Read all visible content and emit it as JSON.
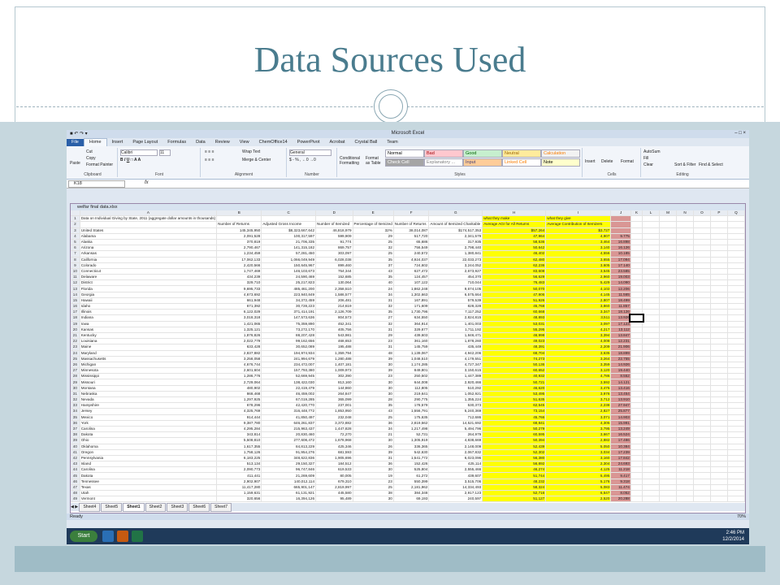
{
  "slide": {
    "title": "Data Sources Used"
  },
  "excel": {
    "window_title": "Microsoft Excel",
    "tabs": [
      "File",
      "Home",
      "Insert",
      "Page Layout",
      "Formulas",
      "Data",
      "Review",
      "View",
      "ChemOffice14",
      "PowerPivot",
      "Acrobat",
      "Crystal Ball",
      "Team"
    ],
    "ribbon": {
      "clipboard": {
        "paste": "Paste",
        "cut": "Cut",
        "copy": "Copy",
        "painter": "Format Painter",
        "label": "Clipboard"
      },
      "font": {
        "name": "Calibri",
        "size": "11",
        "label": "Font"
      },
      "alignment": {
        "wrap": "Wrap Text",
        "merge": "Merge & Center",
        "label": "Alignment"
      },
      "number": {
        "format": "General",
        "label": "Number"
      },
      "styles": {
        "cond": "Conditional Formatting",
        "table": "Format as Table",
        "label": "Styles",
        "cells": [
          {
            "text": "Normal",
            "bg": "#ffffff",
            "fg": "#000000"
          },
          {
            "text": "Bad",
            "bg": "#ffc7ce",
            "fg": "#9c0006"
          },
          {
            "text": "Good",
            "bg": "#c6efce",
            "fg": "#006100"
          },
          {
            "text": "Neutral",
            "bg": "#ffeb9c",
            "fg": "#9c6500"
          },
          {
            "text": "Calculation",
            "bg": "#f2f2f2",
            "fg": "#fa7d00"
          },
          {
            "text": "Check Cell",
            "bg": "#a5a5a5",
            "fg": "#ffffff"
          },
          {
            "text": "Explanatory ...",
            "bg": "#ffffff",
            "fg": "#7f7f7f"
          },
          {
            "text": "Input",
            "bg": "#ffcc99",
            "fg": "#3f3f76"
          },
          {
            "text": "Linked Cell",
            "bg": "#ffffff",
            "fg": "#fa7d00"
          },
          {
            "text": "Note",
            "bg": "#ffffcc",
            "fg": "#000000"
          }
        ]
      },
      "cells": {
        "insert": "Insert",
        "delete": "Delete",
        "format": "Format",
        "label": "Cells"
      },
      "editing": {
        "autosum": "AutoSum",
        "fill": "Fill",
        "clear": "Clear",
        "sort": "Sort & Filter",
        "find": "Find & Select",
        "label": "Editing"
      }
    },
    "namebox": "K18",
    "fx": "fx",
    "workbook_title": "welfar final data.xlsx",
    "columns": [
      "A",
      "B",
      "C",
      "D",
      "E",
      "F",
      "G",
      "H",
      "I",
      "J",
      "K",
      "L",
      "M",
      "N",
      "O",
      "P",
      "Q"
    ],
    "header_row1": {
      "a": "Data on Individual Giving by State, 2011 (aggregate dollar amounts in thousands)",
      "h": "what they make",
      "i": "what they give"
    },
    "header_row2": [
      "",
      "Number of Returns",
      "Adjusted Gross Income",
      "Number of Itemized",
      "Percentage of Itemized",
      "Number of Returns",
      "Amount of Itemized Charitable",
      "Average AGI for All Returns",
      "Average Contribution of Itemizers",
      ""
    ],
    "rows": [
      [
        "United States",
        "145,345,950",
        "$8,323,667,642",
        "46,818,979",
        "32%",
        "38,014,087",
        "$174,517,353",
        "$57,264",
        "$3,727",
        ""
      ],
      [
        "Alabama",
        "2,091,528",
        "100,317,597",
        "599,909",
        "29",
        "517,720",
        "2,341,579",
        "47,964",
        "4,907",
        "9.775"
      ],
      [
        "Alaska",
        "370,819",
        "21,706,335",
        "91,774",
        "25",
        "65,686",
        "317,935",
        "58,536",
        "3,464",
        "16.898"
      ],
      [
        "Arizona",
        "2,790,467",
        "141,315,182",
        "869,757",
        "32",
        "756,549",
        "2,798,440",
        "50,642",
        "3,140",
        "16.126"
      ],
      [
        "Arkansas",
        "1,234,459",
        "57,281,450",
        "303,097",
        "25",
        "240,572",
        "1,380,841",
        "46,402",
        "4,556",
        "10.185"
      ],
      [
        "California",
        "17,062,133",
        "1,066,049,949",
        "6,028,038",
        "35",
        "4,924,037",
        "22,033,273",
        "62,480",
        "3,655",
        "17.094"
      ],
      [
        "Colorado",
        "2,420,566",
        "150,645,967",
        "899,460",
        "37",
        "724,602",
        "3,244,052",
        "62,236",
        "3,605",
        "17.140"
      ],
      [
        "Connecticut",
        "1,747,469",
        "146,103,673",
        "754,344",
        "43",
        "627,472",
        "2,673,927",
        "83,608",
        "3,545",
        "23.585"
      ],
      [
        "Delaware",
        "434,239",
        "24,590,469",
        "152,685",
        "35",
        "124,457",
        "454,370",
        "56,629",
        "2,960",
        "19.003"
      ],
      [
        "District",
        "329,710",
        "25,217,823",
        "130,064",
        "40",
        "107,122",
        "710,044",
        "76,483",
        "5,429",
        "14.090"
      ],
      [
        "Florida",
        "9,695,733",
        "485,461,200",
        "2,358,510",
        "24",
        "1,862,248",
        "9,674,105",
        "50,070",
        "4,102",
        "12.206"
      ],
      [
        "Georgia",
        "4,673,692",
        "223,940,849",
        "1,586,577",
        "34",
        "1,302,663",
        "6,575,664",
        "47,906",
        "4,145",
        "11.565"
      ],
      [
        "Hawaii",
        "661,948",
        "34,372,459",
        "206,481",
        "31",
        "167,891",
        "579,539",
        "51,926",
        "2,807",
        "18.499"
      ],
      [
        "Idaho",
        "671,392",
        "30,728,223",
        "214,619",
        "32",
        "171,609",
        "828,328",
        "45,768",
        "3,860",
        "11.857"
      ],
      [
        "Illinois",
        "6,122,029",
        "371,414,191",
        "2,126,709",
        "35",
        "1,730,796",
        "7,117,252",
        "60,668",
        "3,347",
        "18.126"
      ],
      [
        "Indiana",
        "3,018,318",
        "147,573,636",
        "804,573",
        "27",
        "634,550",
        "2,824,815",
        "48,893",
        "3,511",
        "13.926"
      ],
      [
        "Iowa",
        "1,421,065",
        "75,359,890",
        "452,341",
        "32",
        "364,914",
        "1,401,003",
        "53,031",
        "3,097",
        "17.123"
      ],
      [
        "Kansas",
        "1,325,121",
        "73,272,170",
        "405,756",
        "31",
        "329,677",
        "1,711,192",
        "55,295",
        "4,217",
        "13.112"
      ],
      [
        "Kentucky",
        "1,876,826",
        "88,207,428",
        "543,981",
        "29",
        "439,603",
        "1,846,471",
        "46,998",
        "3,394",
        "13.847"
      ],
      [
        "Louisiana",
        "2,022,779",
        "99,162,656",
        "468,653",
        "23",
        "361,160",
        "1,878,260",
        "49,023",
        "4,008",
        "12.231"
      ],
      [
        "Maine",
        "633,428",
        "30,652,089",
        "195,488",
        "31",
        "145,759",
        "435,449",
        "48,391",
        "2,209",
        "21.906"
      ],
      [
        "Maryland",
        "2,837,882",
        "194,974,934",
        "1,359,794",
        "48",
        "1,139,067",
        "4,942,206",
        "68,704",
        "3,635",
        "18.899"
      ],
      [
        "Massachusetts",
        "3,258,058",
        "241,994,679",
        "1,280,488",
        "39",
        "1,048,510",
        "4,179,551",
        "74,273",
        "3,264",
        "22.755"
      ],
      [
        "Michigan",
        "4,676,744",
        "234,472,007",
        "1,407,181",
        "30",
        "1,174,285",
        "4,727,347",
        "50,136",
        "3,359",
        "14.926"
      ],
      [
        "Minnesota",
        "2,601,604",
        "157,793,380",
        "1,009,973",
        "39",
        "849,801",
        "3,150,615",
        "60,652",
        "3,120",
        "19.440"
      ],
      [
        "Mississippi",
        "1,286,776",
        "52,669,945",
        "302,390",
        "23",
        "250,502",
        "1,447,389",
        "40,932",
        "4,786",
        "8.552"
      ],
      [
        "Missouri",
        "2,729,064",
        "138,422,030",
        "813,160",
        "30",
        "644,008",
        "2,920,466",
        "50,721",
        "3,592",
        "14.121"
      ],
      [
        "Montana",
        "480,902",
        "22,419,479",
        "144,860",
        "30",
        "112,805",
        "510,292",
        "46,620",
        "3,475",
        "13.416"
      ],
      [
        "Nebraska",
        "868,468",
        "46,459,002",
        "264,847",
        "30",
        "219,641",
        "1,052,921",
        "53,495",
        "3,976",
        "13.454"
      ],
      [
        "Nevada",
        "1,297,925",
        "67,019,285",
        "365,099",
        "28",
        "290,775",
        "1,355,224",
        "51,635",
        "3,712",
        "13.910"
      ],
      [
        "Hampshire",
        "678,296",
        "42,420,770",
        "237,001",
        "35",
        "178,579",
        "530,373",
        "62,545",
        "2,238",
        "27.947"
      ],
      [
        "Jersey",
        "4,325,769",
        "316,448,772",
        "1,853,950",
        "43",
        "1,556,791",
        "5,240,369",
        "73,154",
        "2,827",
        "25.877"
      ],
      [
        "Mexico",
        "914,444",
        "41,850,497",
        "232,048",
        "25",
        "175,635",
        "712,686",
        "45,766",
        "3,071",
        "14.903"
      ],
      [
        "York",
        "9,387,780",
        "646,261,837",
        "3,372,882",
        "36",
        "2,819,562",
        "14,521,692",
        "68,841",
        "4,305",
        "15.991"
      ],
      [
        "Carolina",
        "4,295,284",
        "215,963,437",
        "1,447,828",
        "34",
        "1,217,498",
        "5,494,796",
        "50,279",
        "3,795",
        "13.249"
      ],
      [
        "Dakota",
        "343,814",
        "20,830,460",
        "72,270",
        "21",
        "52,731",
        "264,979",
        "60,595",
        "3,667",
        "16.524"
      ],
      [
        "Ohio",
        "5,508,810",
        "277,608,472",
        "1,678,968",
        "30",
        "1,305,919",
        "4,838,669",
        "50,394",
        "2,882",
        "17.486"
      ],
      [
        "Oklahoma",
        "1,617,355",
        "84,813,229",
        "425,346",
        "26",
        "336,365",
        "2,148,009",
        "52,439",
        "5,050",
        "10.384"
      ],
      [
        "Oregon",
        "1,758,126",
        "91,954,276",
        "681,593",
        "39",
        "542,630",
        "2,067,832",
        "52,302",
        "3,034",
        "17.239"
      ],
      [
        "Pennsylvania",
        "6,183,225",
        "348,622,836",
        "1,905,696",
        "31",
        "1,541,772",
        "6,023,096",
        "56,380",
        "3,160",
        "17.842"
      ],
      [
        "Island",
        "513,134",
        "29,150,327",
        "184,512",
        "36",
        "152,426",
        "425,114",
        "56,892",
        "2,304",
        "24.693"
      ],
      [
        "Carolina",
        "2,090,773",
        "96,747,846",
        "619,533",
        "30",
        "525,804",
        "2,555,466",
        "46,274",
        "4,125",
        "11.218"
      ],
      [
        "Dakota",
        "411,441",
        "21,269,609",
        "80,005",
        "19",
        "61,272",
        "439,607",
        "51,744",
        "5,495",
        "9.417"
      ],
      [
        "Tennessee",
        "2,902,907",
        "140,012,114",
        "679,310",
        "23",
        "550,399",
        "3,515,706",
        "48,232",
        "5,176",
        "9.318"
      ],
      [
        "Texas",
        "11,417,280",
        "665,901,147",
        "2,819,997",
        "25",
        "2,181,962",
        "14,334,493",
        "58,324",
        "5,083",
        "11.474"
      ],
      [
        "Utah",
        "1,159,631",
        "61,131,921",
        "445,580",
        "38",
        "384,348",
        "2,917,123",
        "52,716",
        "6,547",
        "8.052"
      ],
      [
        "Vermont",
        "320,656",
        "16,394,126",
        "95,489",
        "30",
        "69,193",
        "240,597",
        "51,127",
        "2,520",
        "20.288"
      ]
    ],
    "sheet_tabs": [
      "Sheet4",
      "Sheet5",
      "Sheet1",
      "Sheet2",
      "Sheet3",
      "Sheet6",
      "Sheet7"
    ],
    "active_sheet": "Sheet1",
    "status": "Ready",
    "zoom": "70%",
    "clock": {
      "time": "2:46 PM",
      "date": "12/2/2014"
    },
    "start_label": "Start",
    "colors": {
      "yellow": "#ffff00",
      "pink": "#d99694",
      "accent": "#4a7c8e"
    }
  }
}
